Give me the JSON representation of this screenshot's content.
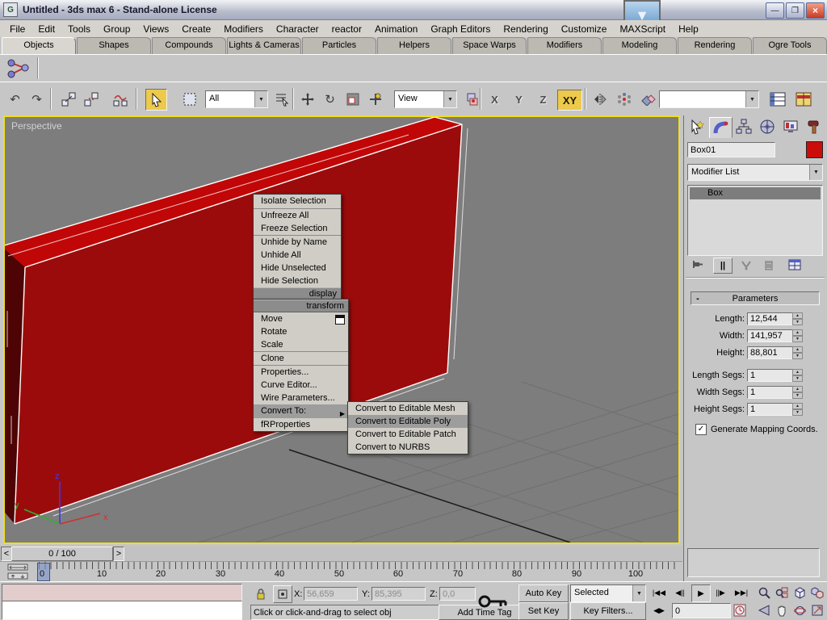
{
  "window": {
    "title": "Untitled - 3ds max 6 - Stand-alone License",
    "minimize": "—",
    "restore": "❐",
    "close": "×",
    "overlay_arrow": "▼",
    "app_logo": "G"
  },
  "menu_bar": {
    "items": [
      "File",
      "Edit",
      "Tools",
      "Group",
      "Views",
      "Create",
      "Modifiers",
      "Character",
      "reactor",
      "Animation",
      "Graph Editors",
      "Rendering",
      "Customize",
      "MAXScript",
      "Help"
    ]
  },
  "tab_bar": {
    "active": "Objects",
    "tabs": [
      "Objects",
      "Shapes",
      "Compounds",
      "Lights & Cameras",
      "Particles",
      "Helpers",
      "Space Warps",
      "Modifiers",
      "Modeling",
      "Rendering",
      "Ogre Tools"
    ]
  },
  "toolbar": {
    "selection_filter": "All",
    "reference_coordsys": "View",
    "named_selection": "",
    "axis_x": "X",
    "axis_y": "Y",
    "axis_z": "Z",
    "axis_xy": "XY",
    "active_axis": "XY"
  },
  "viewport": {
    "label": "Perspective",
    "axis_x": "x",
    "axis_y": "y",
    "axis_z": "z"
  },
  "quad_menu": {
    "display_items": [
      "Isolate Selection",
      "Unfreeze All",
      "Freeze Selection",
      "Unhide by Name",
      "Unhide All",
      "Hide Unselected",
      "Hide Selection"
    ],
    "display_header": "display",
    "transform_header": "transform",
    "transform_items": [
      "Move",
      "Rotate",
      "Scale",
      "Clone",
      "Properties...",
      "Curve Editor...",
      "Wire Parameters...",
      "Convert To:",
      "fRProperties"
    ],
    "highlighted_item": "Convert To:",
    "submenu_items": [
      "Convert to Editable Mesh",
      "Convert to Editable Poly",
      "Convert to Editable Patch",
      "Convert to NURBS"
    ],
    "submenu_highlighted": "Convert to Editable Poly",
    "submenu_arrow": "▶"
  },
  "command_panel": {
    "object_name": "Box01",
    "modifier_list_label": "Modifier List",
    "stack_items": [
      "Box"
    ],
    "stack_show_end_result": "||",
    "rollout": {
      "collapse_glyph": "-",
      "title": "Parameters",
      "fields": [
        {
          "label": "Length:",
          "value": "12,544"
        },
        {
          "label": "Width:",
          "value": "141,957"
        },
        {
          "label": "Height:",
          "value": "88,801"
        },
        {
          "label": "Length Segs:",
          "value": "1"
        },
        {
          "label": "Width Segs:",
          "value": "1"
        },
        {
          "label": "Height Segs:",
          "value": "1"
        }
      ],
      "checkbox_label": "Generate Mapping Coords.",
      "checkbox_checked": true,
      "check_glyph": "✓"
    }
  },
  "timeline": {
    "slider_label": "0 / 100",
    "prev_arrow": "<",
    "next_arrow": ">",
    "ticks": [
      "0",
      "10",
      "20",
      "30",
      "40",
      "50",
      "60",
      "70",
      "80",
      "90",
      "100"
    ]
  },
  "status_bar": {
    "prompt": "Click or click-and-drag to select obj",
    "add_time_tag": "Add Time Tag",
    "x_label": "X:",
    "x_value": "56,659",
    "y_label": "Y:",
    "y_value": "85,395",
    "z_label": "Z:",
    "z_value": "0,0",
    "auto_key": "Auto Key",
    "set_key": "Set Key",
    "selection_set": "Selected",
    "key_filters": "Key Filters...",
    "frame_field": "0"
  },
  "icons": {
    "undo": "↶",
    "redo": "↷",
    "dropdown": "▼",
    "spin_up": "▲",
    "spin_down": "▼",
    "go_start": "|◀◀",
    "prev_frame": "◀||",
    "play": "▶",
    "next_frame": "||▶",
    "go_end": "▶▶|",
    "key_mode": "◀▶"
  },
  "colors": {
    "active_button_yellow": "#edc94c",
    "viewport_border_yellow": "#efdf1f",
    "viewport_bg": "#7d7d7d",
    "box_front_red": "#9c0b0b",
    "box_top_red": "#c00606",
    "box_side_dark": "#4e0404",
    "selection_edge_white": "#ffffff",
    "object_color_swatch": "#cc0b0b",
    "menu_highlight": "#9d9d9d",
    "listener_pink": "#e3cccc",
    "axis_x_red": "#d03030",
    "axis_y_green": "#30b030",
    "axis_z_blue": "#3a3af0"
  }
}
